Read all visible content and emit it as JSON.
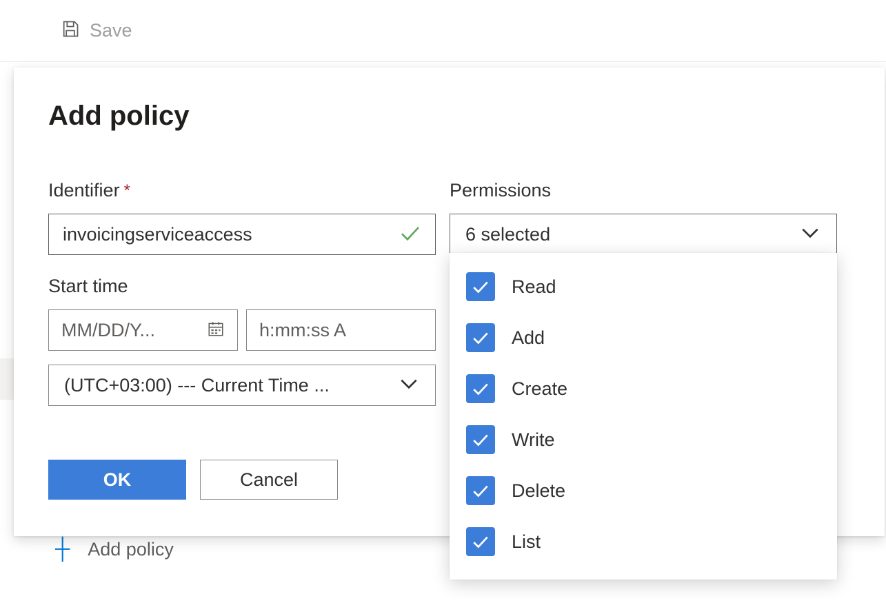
{
  "toolbar": {
    "save_label": "Save"
  },
  "panel": {
    "title": "Add policy",
    "identifier": {
      "label": "Identifier",
      "required_mark": "*",
      "value": "invoicingserviceaccess"
    },
    "start_time": {
      "label": "Start time",
      "date_placeholder": "MM/DD/Y...",
      "time_placeholder": "h:mm:ss A",
      "timezone_text": "(UTC+03:00) --- Current Time ..."
    },
    "permissions": {
      "label": "Permissions",
      "summary": "6 selected",
      "options": [
        {
          "label": "Read",
          "checked": true
        },
        {
          "label": "Add",
          "checked": true
        },
        {
          "label": "Create",
          "checked": true
        },
        {
          "label": "Write",
          "checked": true
        },
        {
          "label": "Delete",
          "checked": true
        },
        {
          "label": "List",
          "checked": true
        }
      ]
    },
    "buttons": {
      "ok": "OK",
      "cancel": "Cancel"
    }
  },
  "behind": {
    "add_policy_label": "Add policy"
  }
}
